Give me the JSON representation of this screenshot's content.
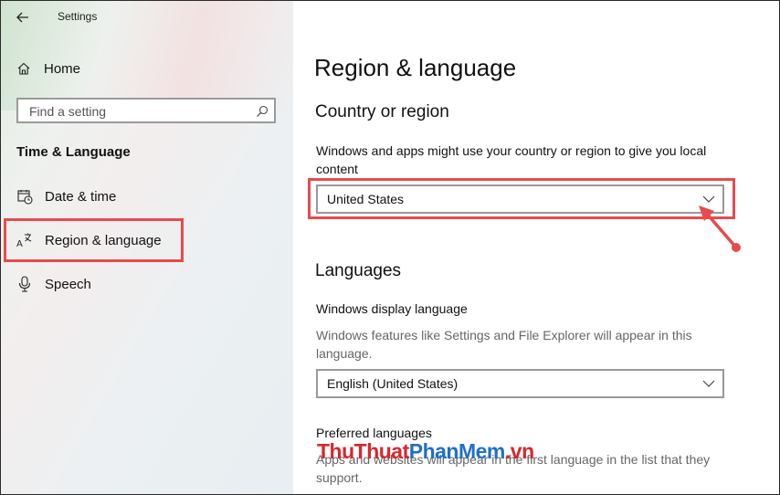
{
  "window": {
    "title": "Settings"
  },
  "sidebar": {
    "home_label": "Home",
    "search": {
      "placeholder": "Find a setting"
    },
    "section_title": "Time & Language",
    "items": [
      {
        "label": "Date & time",
        "icon": "date-time-icon"
      },
      {
        "label": "Region & language",
        "icon": "region-language-icon",
        "selected": true
      },
      {
        "label": "Speech",
        "icon": "microphone-icon"
      }
    ]
  },
  "main": {
    "page_title": "Region & language",
    "country": {
      "heading": "Country or region",
      "description": "Windows and apps might use your country or region to give you local content",
      "selected": "United States"
    },
    "languages": {
      "heading": "Languages",
      "display_label": "Windows display language",
      "display_description": "Windows features like Settings and File Explorer will appear in this language.",
      "display_selected": "English (United States)",
      "preferred_label": "Preferred languages",
      "preferred_description": "Apps and websites will appear in the first language in the list that they support."
    }
  },
  "watermark": {
    "part1": "ThuThuat",
    "part2": "PhanMem",
    "part3": ".vn"
  },
  "colors": {
    "annotation": "#e84a4f",
    "watermark_red": "#d8262c",
    "watermark_blue": "#1f6fc6"
  }
}
